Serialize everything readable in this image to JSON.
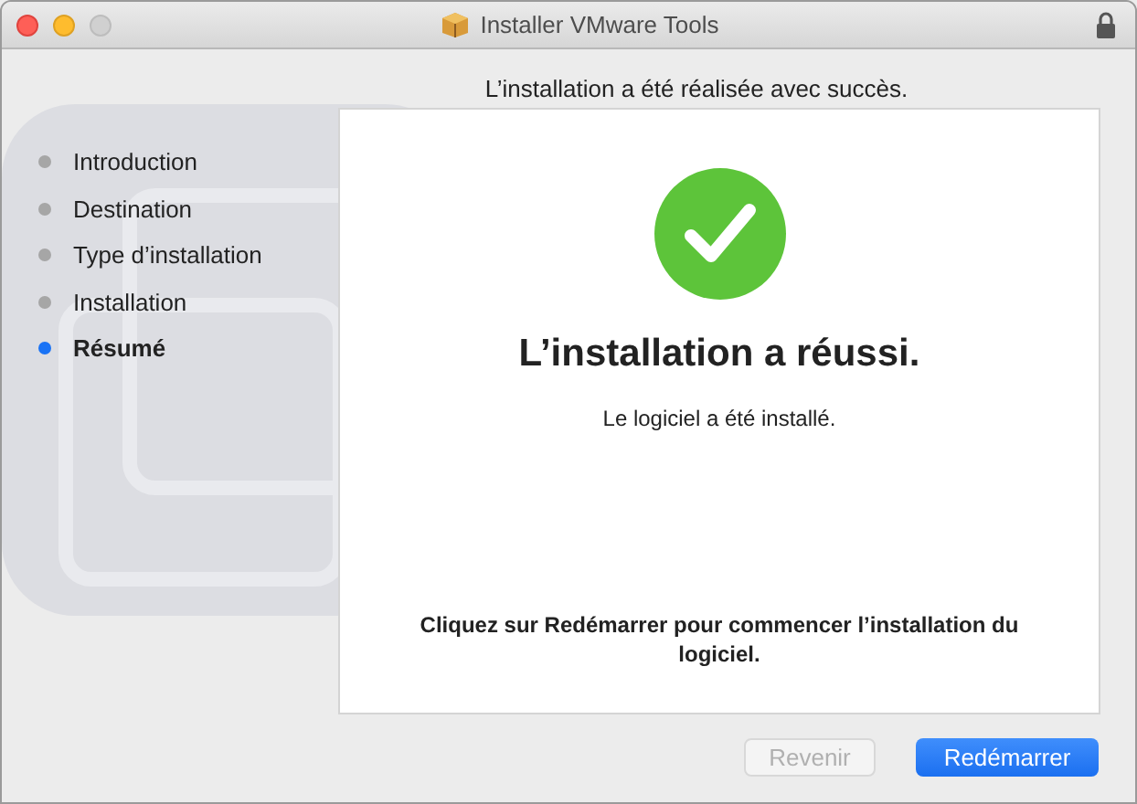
{
  "window": {
    "title": "Installer VMware Tools"
  },
  "header": "L’installation a été réalisée avec succès.",
  "steps": [
    {
      "label": "Introduction",
      "selected": false
    },
    {
      "label": "Destination",
      "selected": false
    },
    {
      "label": "Type d’installation",
      "selected": false
    },
    {
      "label": "Installation",
      "selected": false
    },
    {
      "label": "Résumé",
      "selected": true
    }
  ],
  "content": {
    "heading": "L’installation a réussi.",
    "subtitle": "Le logiciel a été installé.",
    "instruction": "Cliquez sur Redémarrer pour commencer l’installation du logiciel."
  },
  "buttons": [
    {
      "label": "Revenir",
      "disabled": true,
      "default": false
    },
    {
      "label": "Redémarrer",
      "disabled": false,
      "default": true
    }
  ]
}
